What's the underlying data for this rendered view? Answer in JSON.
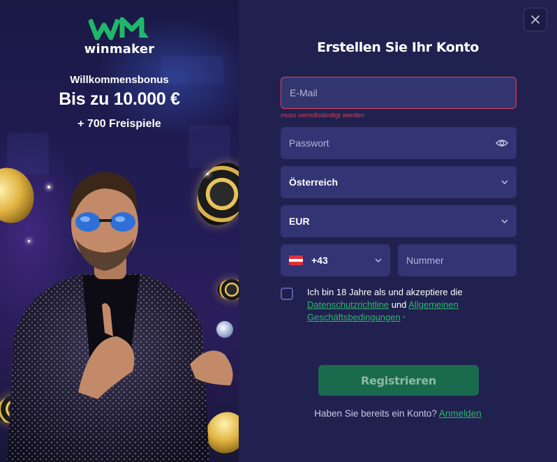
{
  "promo": {
    "logo_text": "winmaker",
    "bonus_label": "Willkommensbonus",
    "bonus_amount": "Bis zu 10.000 €",
    "bonus_spins": "+ 700 Freispiele"
  },
  "form": {
    "title": "Erstellen Sie Ihr Konto",
    "email": {
      "placeholder": "E-Mail",
      "error": "muss vervollständigt werden"
    },
    "password": {
      "placeholder": "Passwort",
      "icon": "eye-icon"
    },
    "country": {
      "value": "Österreich"
    },
    "currency": {
      "value": "EUR"
    },
    "phone": {
      "code": "+43",
      "placeholder": "Nummer",
      "flag": "austria-flag"
    },
    "terms": {
      "text_before": "Ich bin 18 Jahre als und akzeptiere die",
      "privacy_link": "Datenschutzrichtline",
      "conjunction": "und",
      "terms_link_1": "Allgemeinen",
      "terms_link_2": "Geschäftsbedingungen",
      "required_marker": "*"
    },
    "register_label": "Registrieren",
    "login_prompt": "Haben Sie bereits ein Konto?",
    "login_link": "Anmelden"
  },
  "colors": {
    "accent_green": "#29b86c",
    "error_red": "#e0435c",
    "panel_bg": "#20214f",
    "field_bg": "#323474",
    "logo_green": "#1fb86a"
  }
}
